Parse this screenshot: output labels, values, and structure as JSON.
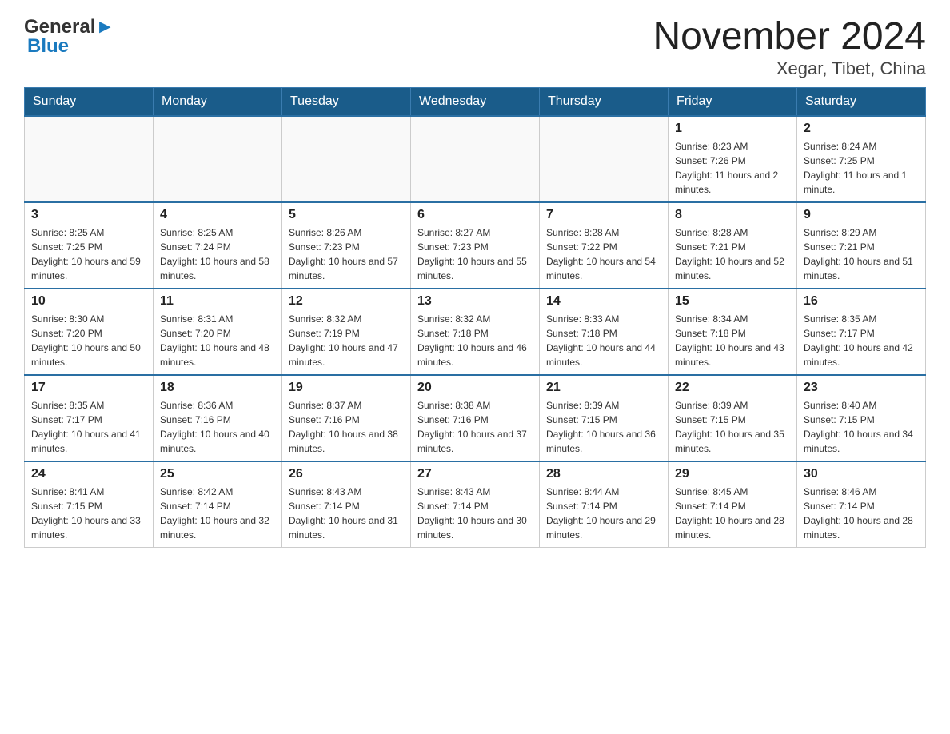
{
  "logo": {
    "general": "General",
    "blue": "Blue"
  },
  "title": "November 2024",
  "subtitle": "Xegar, Tibet, China",
  "weekdays": [
    "Sunday",
    "Monday",
    "Tuesday",
    "Wednesday",
    "Thursday",
    "Friday",
    "Saturday"
  ],
  "weeks": [
    [
      {
        "day": "",
        "info": ""
      },
      {
        "day": "",
        "info": ""
      },
      {
        "day": "",
        "info": ""
      },
      {
        "day": "",
        "info": ""
      },
      {
        "day": "",
        "info": ""
      },
      {
        "day": "1",
        "info": "Sunrise: 8:23 AM\nSunset: 7:26 PM\nDaylight: 11 hours and 2 minutes."
      },
      {
        "day": "2",
        "info": "Sunrise: 8:24 AM\nSunset: 7:25 PM\nDaylight: 11 hours and 1 minute."
      }
    ],
    [
      {
        "day": "3",
        "info": "Sunrise: 8:25 AM\nSunset: 7:25 PM\nDaylight: 10 hours and 59 minutes."
      },
      {
        "day": "4",
        "info": "Sunrise: 8:25 AM\nSunset: 7:24 PM\nDaylight: 10 hours and 58 minutes."
      },
      {
        "day": "5",
        "info": "Sunrise: 8:26 AM\nSunset: 7:23 PM\nDaylight: 10 hours and 57 minutes."
      },
      {
        "day": "6",
        "info": "Sunrise: 8:27 AM\nSunset: 7:23 PM\nDaylight: 10 hours and 55 minutes."
      },
      {
        "day": "7",
        "info": "Sunrise: 8:28 AM\nSunset: 7:22 PM\nDaylight: 10 hours and 54 minutes."
      },
      {
        "day": "8",
        "info": "Sunrise: 8:28 AM\nSunset: 7:21 PM\nDaylight: 10 hours and 52 minutes."
      },
      {
        "day": "9",
        "info": "Sunrise: 8:29 AM\nSunset: 7:21 PM\nDaylight: 10 hours and 51 minutes."
      }
    ],
    [
      {
        "day": "10",
        "info": "Sunrise: 8:30 AM\nSunset: 7:20 PM\nDaylight: 10 hours and 50 minutes."
      },
      {
        "day": "11",
        "info": "Sunrise: 8:31 AM\nSunset: 7:20 PM\nDaylight: 10 hours and 48 minutes."
      },
      {
        "day": "12",
        "info": "Sunrise: 8:32 AM\nSunset: 7:19 PM\nDaylight: 10 hours and 47 minutes."
      },
      {
        "day": "13",
        "info": "Sunrise: 8:32 AM\nSunset: 7:18 PM\nDaylight: 10 hours and 46 minutes."
      },
      {
        "day": "14",
        "info": "Sunrise: 8:33 AM\nSunset: 7:18 PM\nDaylight: 10 hours and 44 minutes."
      },
      {
        "day": "15",
        "info": "Sunrise: 8:34 AM\nSunset: 7:18 PM\nDaylight: 10 hours and 43 minutes."
      },
      {
        "day": "16",
        "info": "Sunrise: 8:35 AM\nSunset: 7:17 PM\nDaylight: 10 hours and 42 minutes."
      }
    ],
    [
      {
        "day": "17",
        "info": "Sunrise: 8:35 AM\nSunset: 7:17 PM\nDaylight: 10 hours and 41 minutes."
      },
      {
        "day": "18",
        "info": "Sunrise: 8:36 AM\nSunset: 7:16 PM\nDaylight: 10 hours and 40 minutes."
      },
      {
        "day": "19",
        "info": "Sunrise: 8:37 AM\nSunset: 7:16 PM\nDaylight: 10 hours and 38 minutes."
      },
      {
        "day": "20",
        "info": "Sunrise: 8:38 AM\nSunset: 7:16 PM\nDaylight: 10 hours and 37 minutes."
      },
      {
        "day": "21",
        "info": "Sunrise: 8:39 AM\nSunset: 7:15 PM\nDaylight: 10 hours and 36 minutes."
      },
      {
        "day": "22",
        "info": "Sunrise: 8:39 AM\nSunset: 7:15 PM\nDaylight: 10 hours and 35 minutes."
      },
      {
        "day": "23",
        "info": "Sunrise: 8:40 AM\nSunset: 7:15 PM\nDaylight: 10 hours and 34 minutes."
      }
    ],
    [
      {
        "day": "24",
        "info": "Sunrise: 8:41 AM\nSunset: 7:15 PM\nDaylight: 10 hours and 33 minutes."
      },
      {
        "day": "25",
        "info": "Sunrise: 8:42 AM\nSunset: 7:14 PM\nDaylight: 10 hours and 32 minutes."
      },
      {
        "day": "26",
        "info": "Sunrise: 8:43 AM\nSunset: 7:14 PM\nDaylight: 10 hours and 31 minutes."
      },
      {
        "day": "27",
        "info": "Sunrise: 8:43 AM\nSunset: 7:14 PM\nDaylight: 10 hours and 30 minutes."
      },
      {
        "day": "28",
        "info": "Sunrise: 8:44 AM\nSunset: 7:14 PM\nDaylight: 10 hours and 29 minutes."
      },
      {
        "day": "29",
        "info": "Sunrise: 8:45 AM\nSunset: 7:14 PM\nDaylight: 10 hours and 28 minutes."
      },
      {
        "day": "30",
        "info": "Sunrise: 8:46 AM\nSunset: 7:14 PM\nDaylight: 10 hours and 28 minutes."
      }
    ]
  ]
}
